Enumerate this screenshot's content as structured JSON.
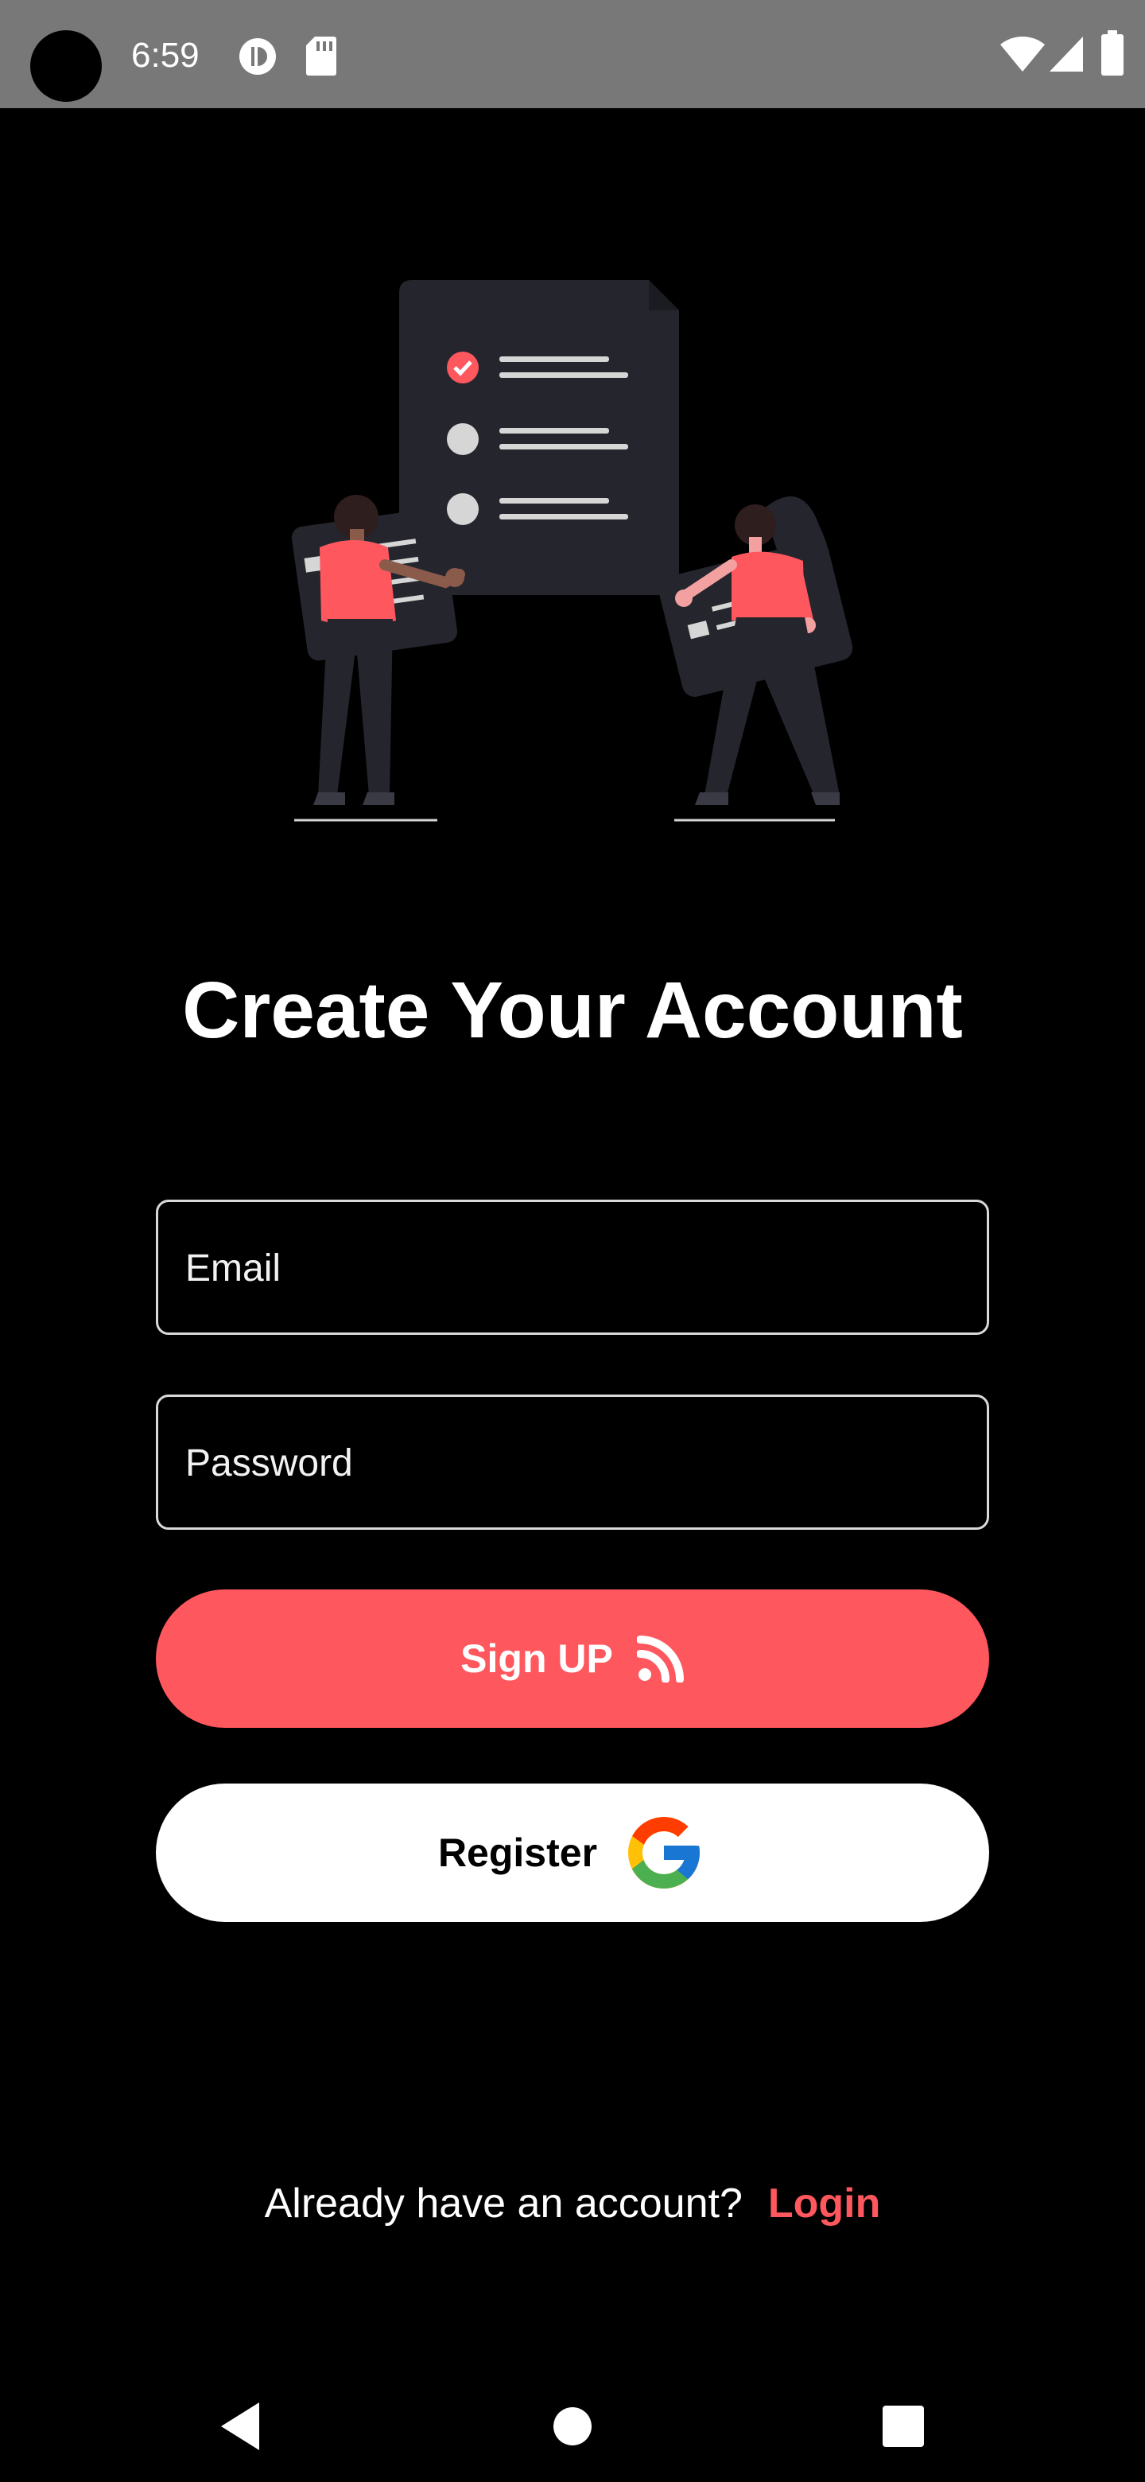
{
  "status_bar": {
    "time": "6:59",
    "icons": [
      "camera-cutout",
      "data-saver-icon",
      "sd-card-icon",
      "wifi-icon",
      "signal-icon",
      "battery-icon"
    ]
  },
  "colors": {
    "background": "#000000",
    "accent": "#ff575e",
    "status_bar": "#787878",
    "illustration_dark": "#25252e"
  },
  "illustration": {
    "icon": "signup-illustration"
  },
  "title": "Create Your Account",
  "form": {
    "email_placeholder": "Email",
    "password_placeholder": "Password"
  },
  "buttons": {
    "signup_label": "Sign UP",
    "signup_icon": "rss-icon",
    "register_label": "Register",
    "register_icon": "google-icon"
  },
  "footer": {
    "question": "Already have an account?",
    "login_label": "Login"
  },
  "nav_bar": {
    "icons": [
      "back-icon",
      "home-icon",
      "recents-icon"
    ]
  }
}
